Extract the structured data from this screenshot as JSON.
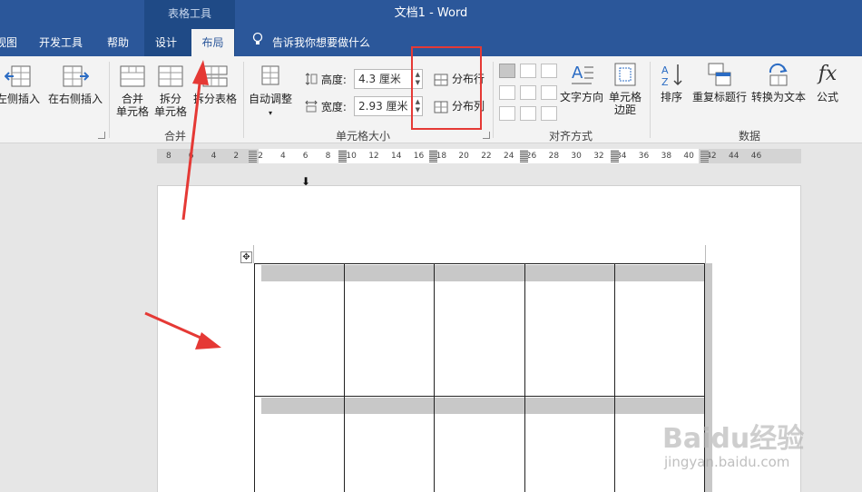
{
  "title_bar": {
    "context_tab": "表格工具",
    "doc_title": "文档1  -  Word"
  },
  "tabs": [
    {
      "label": "视图"
    },
    {
      "label": "开发工具"
    },
    {
      "label": "帮助"
    },
    {
      "label": "设计"
    },
    {
      "label": "布局"
    }
  ],
  "tell_me": "告诉我你想要做什么",
  "ribbon": {
    "insert_left": "左侧插入",
    "insert_right": "在右侧插入",
    "merge_cells": [
      "合并",
      "单元格"
    ],
    "split_cells": [
      "拆分",
      "单元格"
    ],
    "split_table": "拆分表格",
    "group_merge": "合并",
    "autofit": "自动调整",
    "height_label": "高度:",
    "height_value": "4.3 厘米",
    "width_label": "宽度:",
    "width_value": "2.93 厘米",
    "distribute_rows": "分布行",
    "distribute_cols": "分布列",
    "group_cell_size": "单元格大小",
    "text_direction": "文字方向",
    "cell_margins": [
      "单元格",
      "边距"
    ],
    "group_alignment": "对齐方式",
    "sort": "排序",
    "repeat_header": "重复标题行",
    "convert_text": "转换为文本",
    "formula": "公式",
    "formula_glyph": "fx",
    "group_data": "数据"
  },
  "ruler": {
    "ticks": [
      "8",
      "6",
      "4",
      "2",
      "2",
      "4",
      "6",
      "8",
      "10",
      "12",
      "14",
      "16",
      "18",
      "20",
      "22",
      "24",
      "26",
      "28",
      "30",
      "32",
      "34",
      "36",
      "38",
      "40",
      "42",
      "44",
      "46"
    ]
  },
  "watermark": {
    "brand": "Baidu经验",
    "url": "jingyan.baidu.com"
  },
  "colors": {
    "accent": "#2b579a",
    "annotation": "#e53935"
  }
}
